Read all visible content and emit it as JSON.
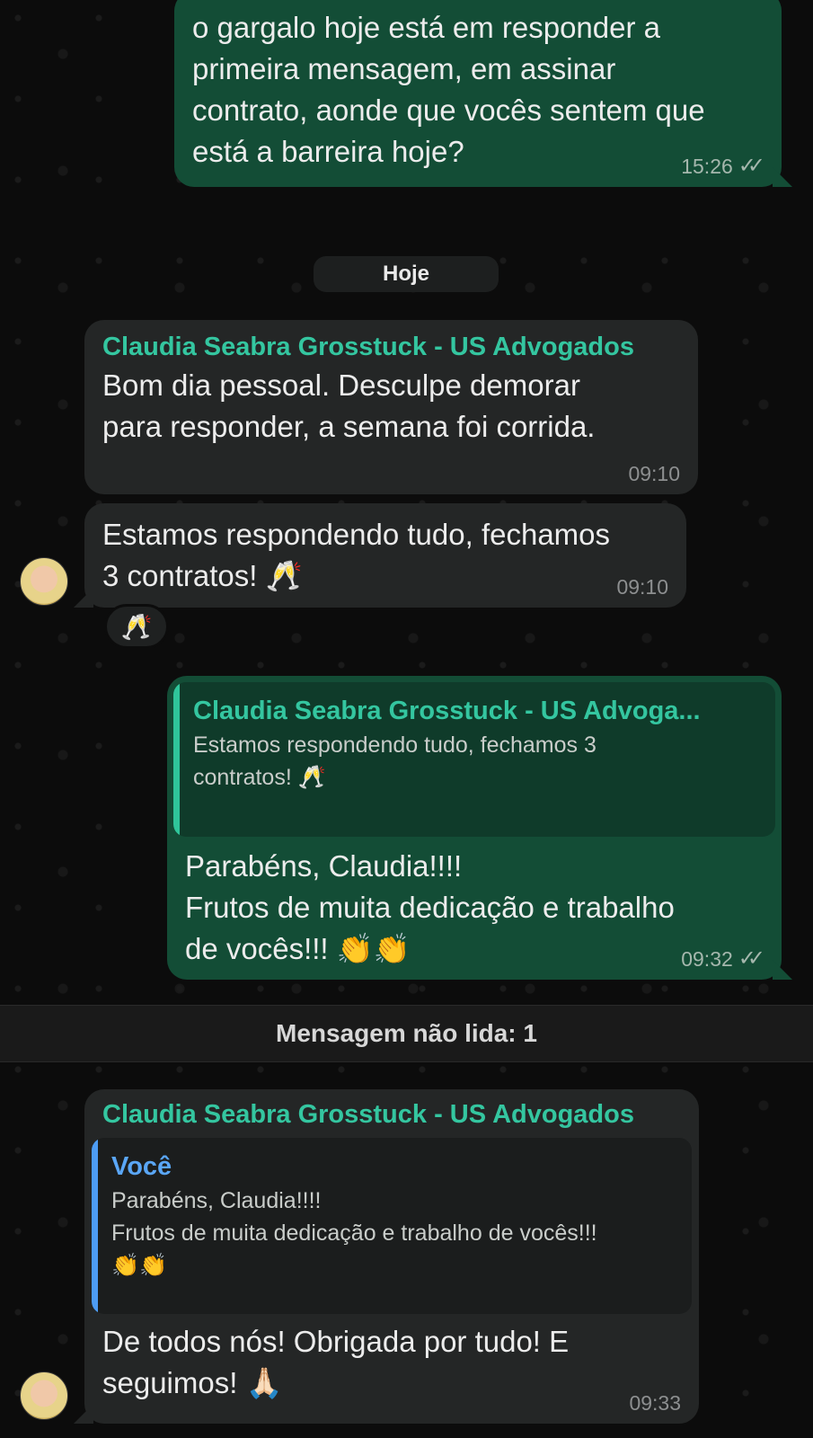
{
  "messages": {
    "m1": {
      "text": "o gargalo hoje está em responder a\nprimeira mensagem, em assinar\ncontrato, aonde que vocês sentem que\nestá a barreira hoje?",
      "time": "15:26",
      "status": "read"
    },
    "date_separator": "Hoje",
    "m2": {
      "sender": "Claudia Seabra Grosstuck - US Advogados",
      "text": "Bom dia pessoal. Desculpe demorar\npara responder, a semana foi corrida.",
      "time": "09:10"
    },
    "m3": {
      "text": "Estamos respondendo tudo, fechamos\n3 contratos! 🥂",
      "time": "09:10",
      "reaction": "🥂"
    },
    "m4": {
      "quote_author": "Claudia Seabra Grosstuck - US Advoga...",
      "quote_text": "Estamos respondendo tudo, fechamos 3\ncontratos! 🥂",
      "text": "Parabéns, Claudia!!!!\nFrutos de muita dedicação e trabalho\nde vocês!!! 👏👏",
      "time": "09:32",
      "status": "read"
    },
    "unread_label": "Mensagem não lida: 1",
    "m5": {
      "sender": "Claudia Seabra Grosstuck - US Advogados",
      "quote_author": "Você",
      "quote_text": "Parabéns, Claudia!!!!\nFrutos de muita dedicação e trabalho de vocês!!!\n👏👏",
      "text": "De todos nós! Obrigada por tudo! E\nseguimos! 🙏🏻",
      "time": "09:33"
    }
  },
  "colors": {
    "outgoing_bubble": "#134d36",
    "incoming_bubble": "#242626",
    "sender_name": "#34c6a0",
    "quote_you": "#5aa6f6"
  }
}
